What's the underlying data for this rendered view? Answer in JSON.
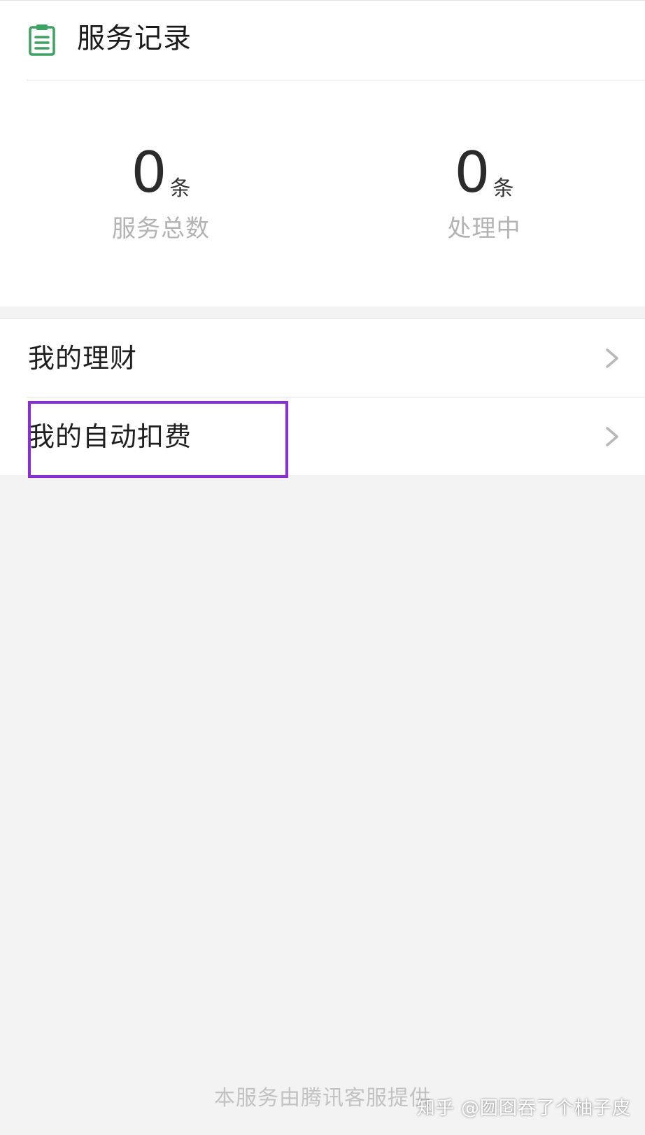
{
  "header": {
    "title": "服务记录",
    "icon": "clipboard-icon",
    "icon_color": "#3aa35f"
  },
  "stats": [
    {
      "value": "0",
      "unit": "条",
      "label": "服务总数"
    },
    {
      "value": "0",
      "unit": "条",
      "label": "处理中"
    }
  ],
  "menu": {
    "items": [
      {
        "label": "我的理财",
        "icon": "chevron-right-icon"
      },
      {
        "label": "我的自动扣费",
        "icon": "chevron-right-icon"
      }
    ]
  },
  "highlight": {
    "color": "#8a2be2"
  },
  "footer": {
    "text": "本服务由腾讯客服提供"
  },
  "watermark": {
    "text": "知乎 @囫囵吞了个柚子皮"
  }
}
